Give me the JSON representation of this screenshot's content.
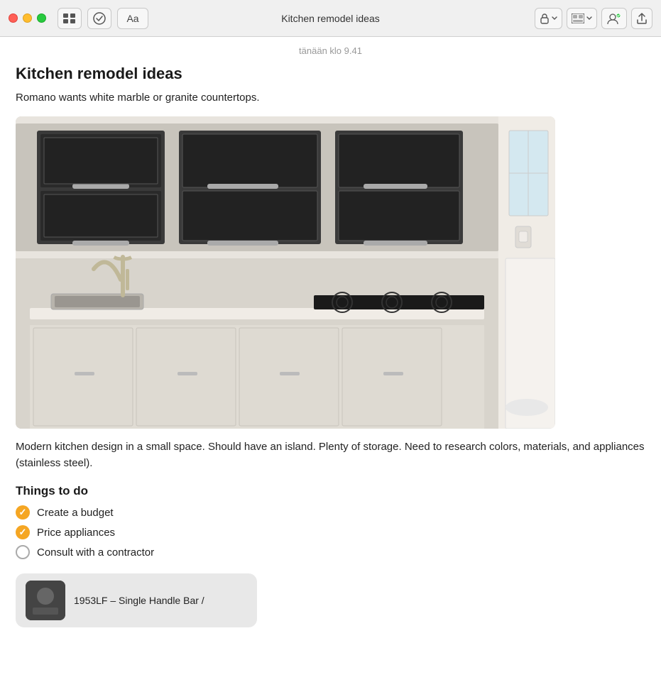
{
  "titlebar": {
    "title": "Kitchen remodel ideas",
    "traffic_lights": {
      "close": "close",
      "minimize": "minimize",
      "maximize": "maximize"
    },
    "toolbar": {
      "grid_icon": "⊞",
      "checklist_icon": "✓",
      "font_label": "Aa",
      "lock_icon": "🔒",
      "chevron_icon": "⌄",
      "gallery_icon": "⊟",
      "avatar_icon": "👤",
      "share_icon": "↑"
    }
  },
  "content": {
    "timestamp": "tänään klo 9.41",
    "note_title": "Kitchen remodel ideas",
    "subtitle": "Romano wants white marble or granite countertops.",
    "description": "Modern kitchen design in a small space. Should have an island. Plenty of storage. Need to research colors, materials, and appliances (stainless steel).",
    "section_heading": "Things to do",
    "todos": [
      {
        "label": "Create a budget",
        "checked": true
      },
      {
        "label": "Price appliances",
        "checked": true
      },
      {
        "label": "Consult with a contractor",
        "checked": false
      }
    ],
    "attachment": {
      "label": "1953LF – Single Handle Bar /"
    }
  }
}
